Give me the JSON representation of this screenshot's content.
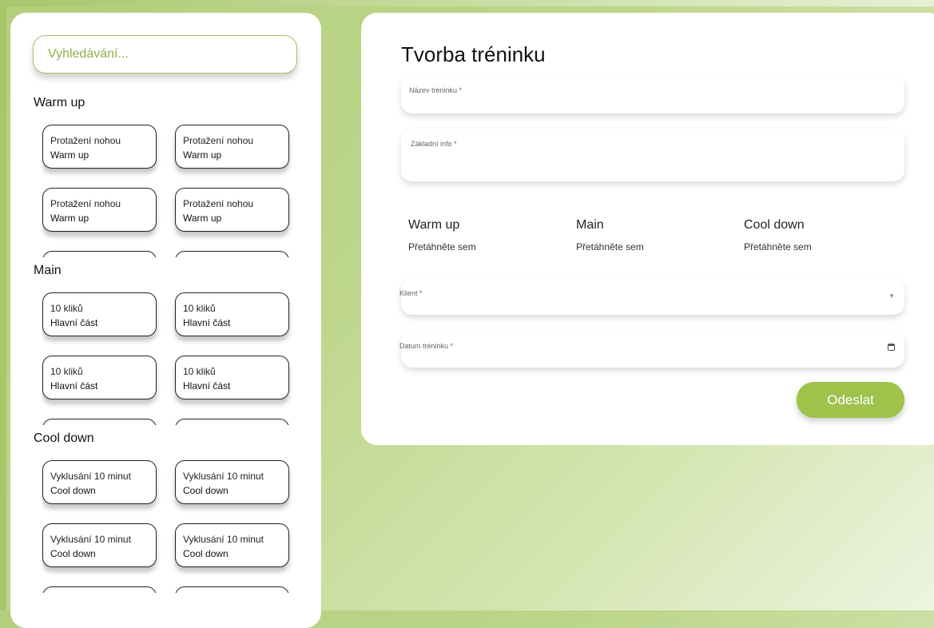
{
  "search": {
    "placeholder": "Vyhledávání..."
  },
  "sidebar": {
    "sections": [
      {
        "title": "Warm up",
        "cards": [
          {
            "line1": "Protažení nohou",
            "line2": "Warm up"
          },
          {
            "line1": "Protažení nohou",
            "line2": "Warm up"
          },
          {
            "line1": "Protažení nohou",
            "line2": "Warm up"
          },
          {
            "line1": "Protažení nohou",
            "line2": "Warm up"
          }
        ]
      },
      {
        "title": "Main",
        "cards": [
          {
            "line1": "10 kliků",
            "line2": "Hlavní část"
          },
          {
            "line1": "10 kliků",
            "line2": "Hlavní část"
          },
          {
            "line1": "10 kliků",
            "line2": "Hlavní část"
          },
          {
            "line1": "10 kliků",
            "line2": "Hlavní část"
          }
        ]
      },
      {
        "title": "Cool down",
        "cards": [
          {
            "line1": "Vyklusání 10 minut",
            "line2": "Cool down"
          },
          {
            "line1": "Vyklusání 10 minut",
            "line2": "Cool down"
          },
          {
            "line1": "Vyklusání 10 minut",
            "line2": "Cool down"
          },
          {
            "line1": "Vyklusání 10 minut",
            "line2": "Cool down"
          }
        ]
      }
    ]
  },
  "form": {
    "title": "Tvorba tréninku",
    "name_label": "Název tréninku *",
    "info_label": "Základní info *",
    "columns": [
      {
        "title": "Warm up",
        "drop": "Přetáhněte sem"
      },
      {
        "title": "Main",
        "drop": "Přetáhněte sem"
      },
      {
        "title": "Cool down",
        "drop": "Přetáhněte sem"
      }
    ],
    "client_label": "Klient *",
    "date_label": "Datum tréninku *",
    "submit_label": "Odeslat"
  },
  "icons": {
    "select": "chevron-down-icon",
    "date": "calendar-icon"
  },
  "colors": {
    "accent": "#9fc24b",
    "search_border": "#a6c25f"
  }
}
